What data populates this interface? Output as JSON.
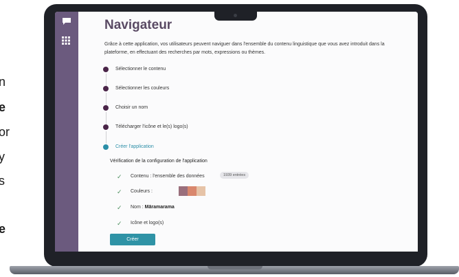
{
  "edge_fragments": [
    {
      "text": "n",
      "bold": false
    },
    {
      "text": "e",
      "bold": true
    },
    {
      "text": "or",
      "bold": false
    },
    {
      "text": "y",
      "bold": false
    },
    {
      "text": "s",
      "bold": false
    },
    {
      "text": "e",
      "bold": true
    }
  ],
  "app": {
    "title": "Navigateur",
    "description": "Grâce à cette application, vos utilisateurs peuvent naviguer dans l'ensemble du contenu linguistique que vous avez introduit dans la plateforme, en effectuant des recherches par mots, expressions ou thèmes.",
    "steps": [
      {
        "label": "Sélectionner le contenu",
        "active": false
      },
      {
        "label": "Sélectionner les couleurs",
        "active": false
      },
      {
        "label": "Choisir un nom",
        "active": false
      },
      {
        "label": "Télécharger l'icône et le(s) logo(s)",
        "active": false
      },
      {
        "label": "Créer l'application",
        "active": true
      }
    ],
    "verification": {
      "title": "Vérification de la configuration de l'application",
      "content_label": "Contenu : l'ensemble des données",
      "content_badge": "1939 entrées",
      "colors_label": "Couleurs :",
      "color_swatches": [
        "#9a6f7c",
        "#d9876d",
        "#e6c3a7"
      ],
      "name_prefix": "Nom :",
      "name_value": "Māramarama",
      "icon_label": "Icône et logo(s)"
    },
    "create_button": "Créer"
  },
  "colors": {
    "sidebar": "#6b5a7e",
    "title": "#5a4a64",
    "step_dot": "#4a2448",
    "accent": "#2f93a6",
    "check": "#4a8d5c"
  }
}
